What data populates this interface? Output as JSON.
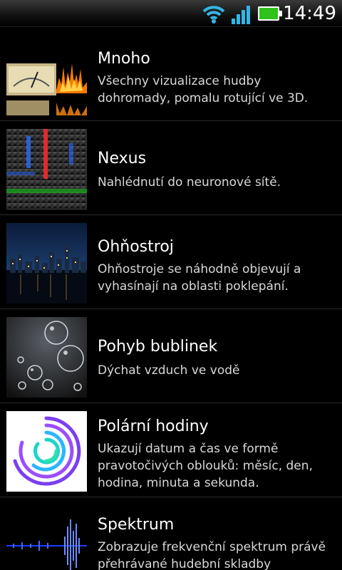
{
  "status_bar": {
    "time": "14:49",
    "icons": [
      "wifi-icon",
      "signal-icon",
      "battery-icon"
    ],
    "battery_color": "#2fc21a",
    "accent": "#33b5e5"
  },
  "items": [
    {
      "title": "Mnoho",
      "description": "Všechny vizualizace hudby dohromady, pomalu rotující ve 3D.",
      "thumbnail": "many-visualizations"
    },
    {
      "title": "Nexus",
      "description": "Nahlédnutí do neuronové sítě.",
      "thumbnail": "nexus-grid"
    },
    {
      "title": "Ohňostroj",
      "description": "Ohňostroje se náhodně objevují a vyhasínají na oblasti poklepání.",
      "thumbnail": "night-skyline"
    },
    {
      "title": "Pohyb bublinek",
      "description": "Dýchat vzduch ve vodě",
      "thumbnail": "bubbles"
    },
    {
      "title": "Polární hodiny",
      "description": "Ukazují datum a čas ve formě pravotočivých oblouků: měsíc, den, hodina, minuta a sekunda.",
      "thumbnail": "polar-clock"
    },
    {
      "title": "Spektrum",
      "description": "Zobrazuje frekvenční spektrum právě přehrávané hudební skladby",
      "thumbnail": "spectrum"
    }
  ]
}
